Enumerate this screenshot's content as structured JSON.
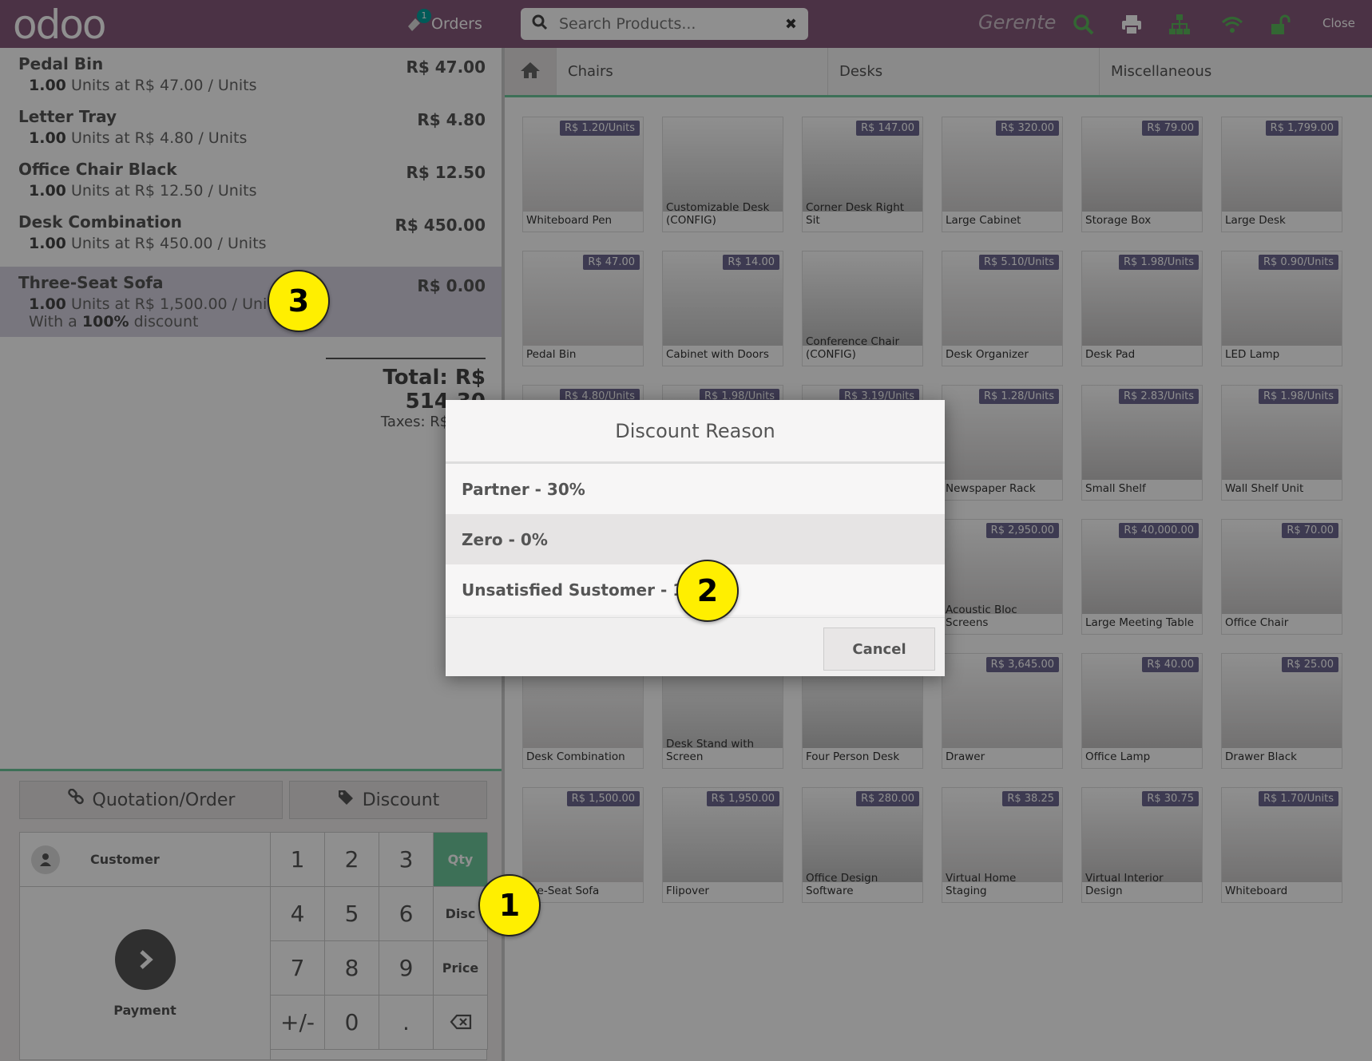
{
  "header": {
    "logo": "odoo",
    "orders_label": "Orders",
    "orders_count": "1",
    "search_placeholder": "Search Products...",
    "cashier": "Gerente",
    "close_label": "Close"
  },
  "order": {
    "lines": [
      {
        "name": "Pedal Bin",
        "price": "R$ 47.00",
        "qty": "1.00",
        "unit_text": "Units at R$ 47.00 / Units",
        "discount": ""
      },
      {
        "name": "Letter Tray",
        "price": "R$ 4.80",
        "qty": "1.00",
        "unit_text": "Units at R$ 4.80 / Units",
        "discount": ""
      },
      {
        "name": "Office Chair Black",
        "price": "R$ 12.50",
        "qty": "1.00",
        "unit_text": "Units at R$ 12.50 / Units",
        "discount": ""
      },
      {
        "name": "Desk Combination",
        "price": "R$ 450.00",
        "qty": "1.00",
        "unit_text": "Units at R$ 450.00 / Units",
        "discount": ""
      },
      {
        "name": "Three-Seat Sofa",
        "price": "R$ 0.00",
        "qty": "1.00",
        "unit_text": "Units at R$ 1,500.00 / Units",
        "discount_prefix": "With a",
        "discount_value": "100%",
        "discount_suffix": "discount"
      }
    ],
    "total": "Total: R$ 514.30",
    "taxes": "Taxes: R$ 0.00"
  },
  "controls": {
    "quotation_label": "Quotation/Order",
    "discount_label": "Discount",
    "customer_label": "Customer",
    "payment_label": "Payment",
    "keys": [
      "1",
      "2",
      "3",
      "4",
      "5",
      "6",
      "7",
      "8",
      "9",
      "+/-",
      "0",
      "."
    ],
    "mode_qty": "Qty",
    "mode_disc": "Disc",
    "mode_price": "Price"
  },
  "categories": {
    "items": [
      "Chairs",
      "Desks",
      "Miscellaneous"
    ]
  },
  "products": [
    {
      "name": "Whiteboard Pen",
      "price": "R$ 1.20/Units"
    },
    {
      "name": "Customizable Desk (CONFIG)",
      "price": ""
    },
    {
      "name": "Corner Desk Right Sit",
      "price": "R$ 147.00"
    },
    {
      "name": "Large Cabinet",
      "price": "R$ 320.00"
    },
    {
      "name": "Storage Box",
      "price": "R$ 79.00"
    },
    {
      "name": "Large Desk",
      "price": "R$ 1,799.00"
    },
    {
      "name": "Pedal Bin",
      "price": "R$ 47.00"
    },
    {
      "name": "Cabinet with Doors",
      "price": "R$ 14.00"
    },
    {
      "name": "Conference Chair (CONFIG)",
      "price": ""
    },
    {
      "name": "Desk Organizer",
      "price": "R$ 5.10/Units"
    },
    {
      "name": "Desk Pad",
      "price": "R$ 1.98/Units"
    },
    {
      "name": "LED Lamp",
      "price": "R$ 0.90/Units"
    },
    {
      "name": "",
      "price": "R$ 4.80/Units"
    },
    {
      "name": "",
      "price": "R$ 1.98/Units"
    },
    {
      "name": "",
      "price": "R$ 3.19/Units"
    },
    {
      "name": "Newspaper Rack",
      "price": "R$ 1.28/Units"
    },
    {
      "name": "Small Shelf",
      "price": "R$ 2.83/Units"
    },
    {
      "name": "Wall Shelf Unit",
      "price": "R$ 1.98/Units"
    },
    {
      "name": "",
      "price": ""
    },
    {
      "name": "",
      "price": ""
    },
    {
      "name": "",
      "price": ""
    },
    {
      "name": "Acoustic Bloc Screens",
      "price": "R$ 2,950.00"
    },
    {
      "name": "Large Meeting Table",
      "price": "R$ 40,000.00"
    },
    {
      "name": "Office Chair",
      "price": "R$ 70.00"
    },
    {
      "name": "Desk Combination",
      "price": ""
    },
    {
      "name": "Desk Stand with Screen",
      "price": ""
    },
    {
      "name": "Four Person Desk",
      "price": ""
    },
    {
      "name": "Drawer",
      "price": "R$ 3,645.00"
    },
    {
      "name": "Office Lamp",
      "price": "R$ 40.00"
    },
    {
      "name": "Drawer Black",
      "price": "R$ 25.00"
    },
    {
      "name": "ree-Seat Sofa",
      "price": "R$ 1,500.00"
    },
    {
      "name": "Flipover",
      "price": "R$ 1,950.00"
    },
    {
      "name": "Office Design Software",
      "price": "R$ 280.00"
    },
    {
      "name": "Virtual Home Staging",
      "price": "R$ 38.25"
    },
    {
      "name": "Virtual Interior Design",
      "price": "R$ 30.75"
    },
    {
      "name": "Whiteboard",
      "price": "R$ 1.70/Units"
    }
  ],
  "modal": {
    "title": "Discount Reason",
    "options": [
      "Partner - 30%",
      "Zero - 0%",
      "Unsatisfied Sustomer - 100%"
    ],
    "cancel_label": "Cancel"
  },
  "callouts": {
    "c1": "1",
    "c2": "2",
    "c3": "3"
  },
  "colors": {
    "topbar": "#875a7b",
    "accent_green": "#6ec89b",
    "price_tag": "#6d6891",
    "callout": "#ffef00"
  }
}
